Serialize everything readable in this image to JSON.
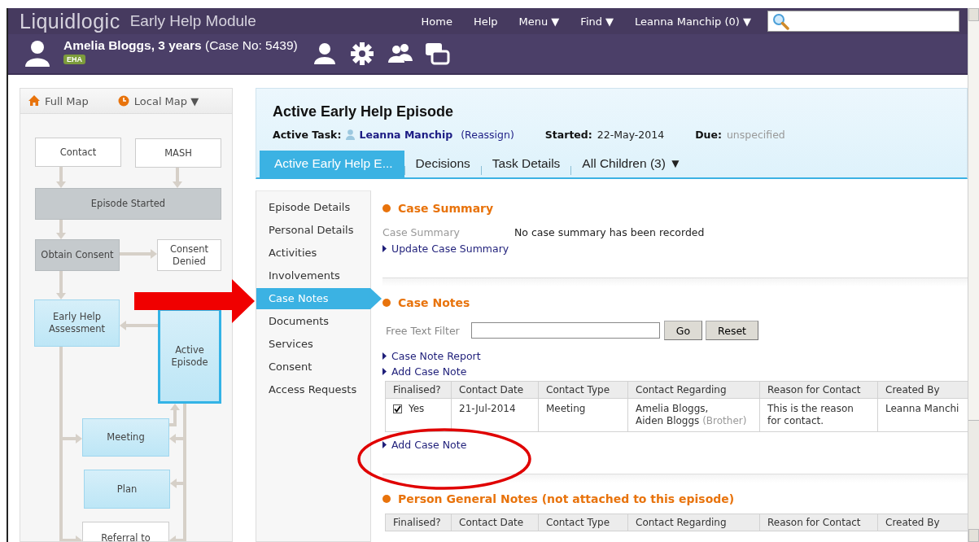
{
  "header": {
    "logo": "Liquidlogic",
    "module": "Early Help Module",
    "nav": [
      {
        "label": "Home"
      },
      {
        "label": "Help"
      },
      {
        "label": "Menu ▼"
      },
      {
        "label": "Find ▼"
      },
      {
        "label": "Leanna Manchip (0) ▼"
      }
    ]
  },
  "person": {
    "name": "Amelia Bloggs, 3 years",
    "case_no": "(Case No: 5439)",
    "badge": "EHA",
    "actions": [
      {
        "kind": "person"
      },
      {
        "kind": "gear"
      },
      {
        "kind": "group"
      },
      {
        "kind": "windows"
      }
    ]
  },
  "map": {
    "buttons": [
      {
        "kind": "home",
        "label": "Full Map"
      },
      {
        "kind": "clock",
        "label": "Local Map ▼"
      }
    ],
    "nodes": [
      {
        "label": "Contact",
        "kind": "plain",
        "selected": false
      },
      {
        "label": "MASH",
        "kind": "plain",
        "selected": false
      },
      {
        "label": "Episode Started",
        "kind": "done",
        "selected": false
      },
      {
        "label": "Obtain Consent",
        "kind": "done",
        "selected": false
      },
      {
        "label": "Consent Denied",
        "kind": "plain",
        "selected": false
      },
      {
        "label": "Early Help Assessment",
        "kind": "stage",
        "selected": false
      },
      {
        "label": "Active Episode",
        "kind": "stage",
        "selected": true
      },
      {
        "label": "Meeting",
        "kind": "stage",
        "selected": false
      },
      {
        "label": "Plan",
        "kind": "stage",
        "selected": false
      },
      {
        "label": "Referral to",
        "kind": "plain",
        "selected": false
      }
    ]
  },
  "episode": {
    "title": "Active Early Help Episode",
    "task_label": "Active Task:",
    "assignee": "Leanna Manchip",
    "reassign": "(Reassign)",
    "started_label": "Started:",
    "started": "22-May-2014",
    "due_label": "Due:",
    "due": "unspecified",
    "tabs": [
      {
        "label": "Active Early Help E...",
        "selected": true
      },
      {
        "label": "Decisions",
        "selected": false
      },
      {
        "label": "Task Details",
        "selected": false
      },
      {
        "label": "All Children (3) ▼",
        "selected": false
      }
    ]
  },
  "side_nav": [
    {
      "label": "Episode Details",
      "selected": false
    },
    {
      "label": "Personal Details",
      "selected": false
    },
    {
      "label": "Activities",
      "selected": false
    },
    {
      "label": "Involvements",
      "selected": false
    },
    {
      "label": "Case Notes",
      "selected": true
    },
    {
      "label": "Documents",
      "selected": false
    },
    {
      "label": "Services",
      "selected": false
    },
    {
      "label": "Consent",
      "selected": false
    },
    {
      "label": "Access Requests",
      "selected": false
    }
  ],
  "case_summary": {
    "heading": "Case Summary",
    "label": "Case Summary",
    "value": "No case summary has been recorded",
    "links": [
      "Update Case Summary"
    ]
  },
  "case_notes": {
    "heading": "Case Notes",
    "filter_label": "Free Text Filter",
    "buttons": [
      "Go",
      "Reset"
    ],
    "links": [
      "Case Note Report",
      "Add Case Note"
    ],
    "table": {
      "columns": [
        "Finalised?",
        "Contact Date",
        "Contact Type",
        "Contact Regarding",
        "Reason for Contact",
        "Created By"
      ],
      "rows": [
        {
          "finalised_checked": true,
          "finalised": "Yes",
          "contact_date": "21-Jul-2014",
          "contact_type": "Meeting",
          "contact_regarding": [
            {
              "name": "Amelia Bloggs,"
            },
            {
              "name": "Aiden Bloggs",
              "relation": "(Brother)"
            }
          ],
          "reason": "This is the reason for contact.",
          "created_by": "Leanna Manchi"
        }
      ]
    },
    "footer_link": "Add Case Note"
  },
  "general_notes": {
    "heading": "Person General Notes (not attached to this episode)",
    "table": {
      "columns": [
        "Finalised?",
        "Contact Date",
        "Contact Type",
        "Contact Regarding",
        "Reason for Contact",
        "Created By"
      ]
    }
  },
  "annotations": [
    {
      "kind": "arrow"
    },
    {
      "kind": "ellipse"
    }
  ]
}
